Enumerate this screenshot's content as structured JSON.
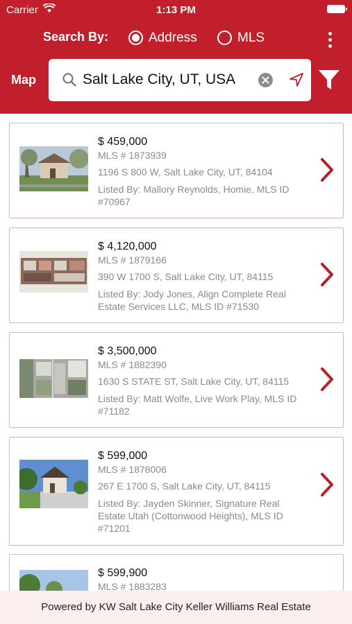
{
  "status_bar": {
    "carrier": "Carrier",
    "time": "1:13 PM"
  },
  "header": {
    "search_by_label": "Search By:",
    "radio_address_label": "Address",
    "radio_mls_label": "MLS",
    "selected_option": "Address",
    "map_label": "Map",
    "search_value": "Salt Lake City, UT, USA",
    "accent_color": "#c11f2c"
  },
  "listings": [
    {
      "price": "$ 459,000",
      "mls": "MLS # 1873939",
      "address": "1196 S 800 W, Salt Lake City, UT, 84104",
      "listed_by": "Listed By: Mallory Reynolds, Homie, MLS ID #70967"
    },
    {
      "price": "$ 4,120,000",
      "mls": "MLS # 1879166",
      "address": "390 W 1700 S, Salt Lake City, UT, 84115",
      "listed_by": "Listed By: Jody Jones, Align Complete Real Estate Services LLC, MLS ID #71530"
    },
    {
      "price": "$ 3,500,000",
      "mls": "MLS # 1882390",
      "address": "1630 S STATE ST, Salt Lake City, UT, 84115",
      "listed_by": "Listed By: Matt Wolfe, Live Work Play, MLS ID #71182"
    },
    {
      "price": "$ 599,000",
      "mls": "MLS # 1878006",
      "address": "267 E 1700 S, Salt Lake City, UT, 84115",
      "listed_by": "Listed By: Jayden Skinner, Signature Real Estate Utah (Cottonwood Heights), MLS ID #71201"
    },
    {
      "price": "$ 599,900",
      "mls": "MLS # 1883283",
      "address": "",
      "listed_by": ""
    }
  ],
  "footer": {
    "text": "Powered by KW Salt Lake City Keller Williams Real Estate"
  }
}
